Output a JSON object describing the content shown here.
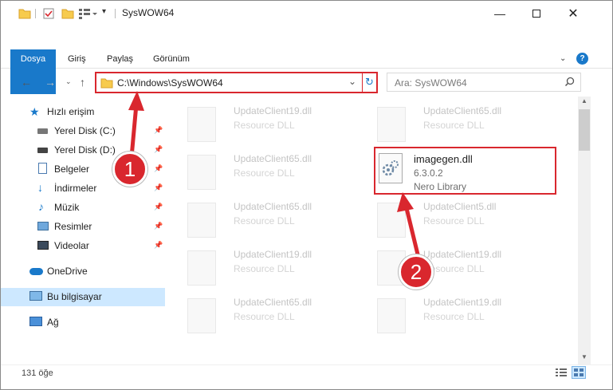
{
  "window": {
    "title": "SysWOW64"
  },
  "ribbon": {
    "tabs": [
      "Dosya",
      "Giriş",
      "Paylaş",
      "Görünüm"
    ],
    "accent": "#1979ca"
  },
  "address": {
    "path": "C:\\Windows\\SysWOW64"
  },
  "search": {
    "placeholder": "Ara: SysWOW64"
  },
  "sidebar": {
    "items": [
      {
        "label": "Hızlı erişim",
        "icon": "star-icon"
      },
      {
        "label": "Yerel Disk (C:)",
        "icon": "drive-icon",
        "pinned": true
      },
      {
        "label": "Yerel Disk (D:)",
        "icon": "drive-icon",
        "pinned": true
      },
      {
        "label": "Belgeler",
        "icon": "documents-icon",
        "pinned": true
      },
      {
        "label": "İndirmeler",
        "icon": "download-icon",
        "pinned": true
      },
      {
        "label": "Müzik",
        "icon": "music-icon",
        "pinned": true
      },
      {
        "label": "Resimler",
        "icon": "pictures-icon",
        "pinned": true
      },
      {
        "label": "Videolar",
        "icon": "video-icon",
        "pinned": true
      },
      {
        "label": "OneDrive",
        "icon": "cloud-icon"
      },
      {
        "label": "Bu bilgisayar",
        "icon": "computer-icon",
        "selected": true
      },
      {
        "label": "Ağ",
        "icon": "network-icon"
      }
    ]
  },
  "files": [
    {
      "name": "UpdateClient19.dll",
      "type": "Resource DLL"
    },
    {
      "name": "UpdateClient65.dll",
      "type": "Resource DLL"
    },
    {
      "name": "UpdateClient65.dll",
      "type": "Resource DLL"
    },
    {
      "name": "imagegen.dll",
      "version": "6.3.0.2",
      "company": "Nero Library",
      "highlight": true
    },
    {
      "name": "UpdateClient65.dll",
      "type": "Resource DLL"
    },
    {
      "name": "UpdateClient5.dll",
      "type": "Resource DLL"
    },
    {
      "name": "UpdateClient19.dll",
      "type": "Resource DLL"
    },
    {
      "name": "UpdateClient19.dll",
      "type": "Resource DLL"
    },
    {
      "name": "UpdateClient65.dll",
      "type": "Resource DLL"
    },
    {
      "name": "UpdateClient19.dll",
      "type": "Resource DLL"
    }
  ],
  "status": {
    "count": "131 öğe"
  },
  "callouts": [
    "1",
    "2"
  ],
  "colors": {
    "annotation_red": "#d9272e",
    "selected_bg": "#cde8ff"
  }
}
